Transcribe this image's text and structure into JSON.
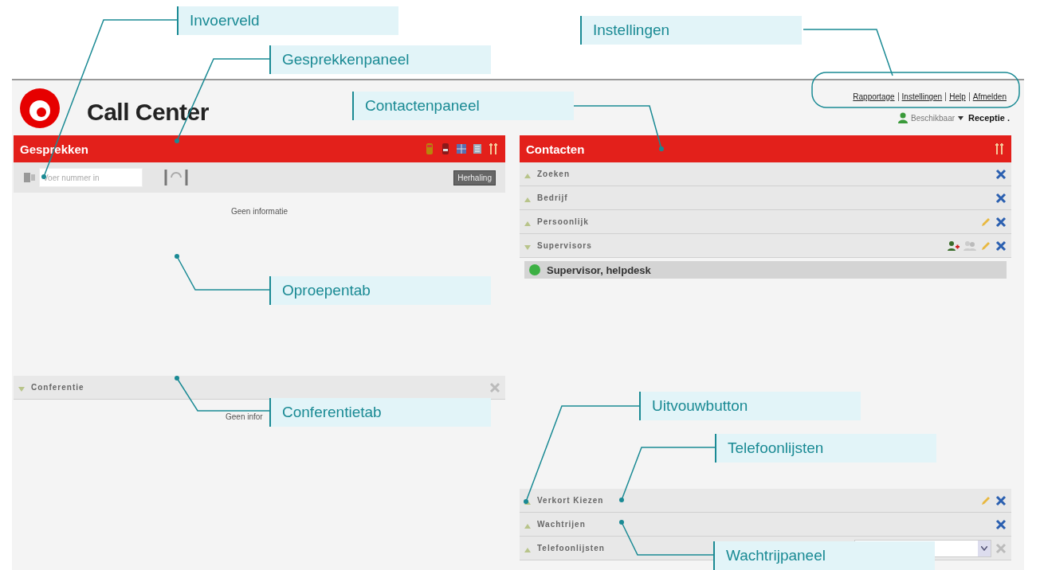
{
  "header": {
    "title": "Call Center",
    "links": [
      "Rapportage",
      "Instellingen",
      "Help",
      "Afmelden"
    ],
    "status": {
      "value": "Beschikbaar",
      "queue": "Receptie ."
    }
  },
  "calls": {
    "title": "Gesprekken",
    "input": {
      "placeholder": "Voer nummer in"
    },
    "repeat_button": "Herhaling",
    "empty": "Geen informatie",
    "conference": {
      "label": "Conferentie",
      "expanded": true,
      "empty": "Geen infor"
    }
  },
  "contacts": {
    "title": "Contacten",
    "sections": [
      {
        "label": "Zoeken",
        "expanded": false
      },
      {
        "label": "Bedrijf",
        "expanded": false
      },
      {
        "label": "Persoonlijk",
        "expanded": false
      },
      {
        "label": "Supervisors",
        "expanded": true,
        "items": [
          {
            "name": "Supervisor, helpdesk",
            "color": "#3cb043"
          }
        ]
      }
    ],
    "bottom_sections": [
      {
        "label": "Verkort Kiezen",
        "expanded": false
      },
      {
        "label": "Wachtrijen",
        "expanded": false
      },
      {
        "label": "Telefoonlijsten",
        "expanded": false
      }
    ]
  },
  "annotations": [
    {
      "label": "Invoerveld"
    },
    {
      "label": "Gesprekkenpaneel"
    },
    {
      "label": "Instellingen"
    },
    {
      "label": "Contactenpaneel"
    },
    {
      "label": "Oproepentab"
    },
    {
      "label": "Conferentietab"
    },
    {
      "label": "Uitvouwbutton"
    },
    {
      "label": "Telefoonlijsten"
    },
    {
      "label": "Wachtrijpaneel"
    }
  ]
}
